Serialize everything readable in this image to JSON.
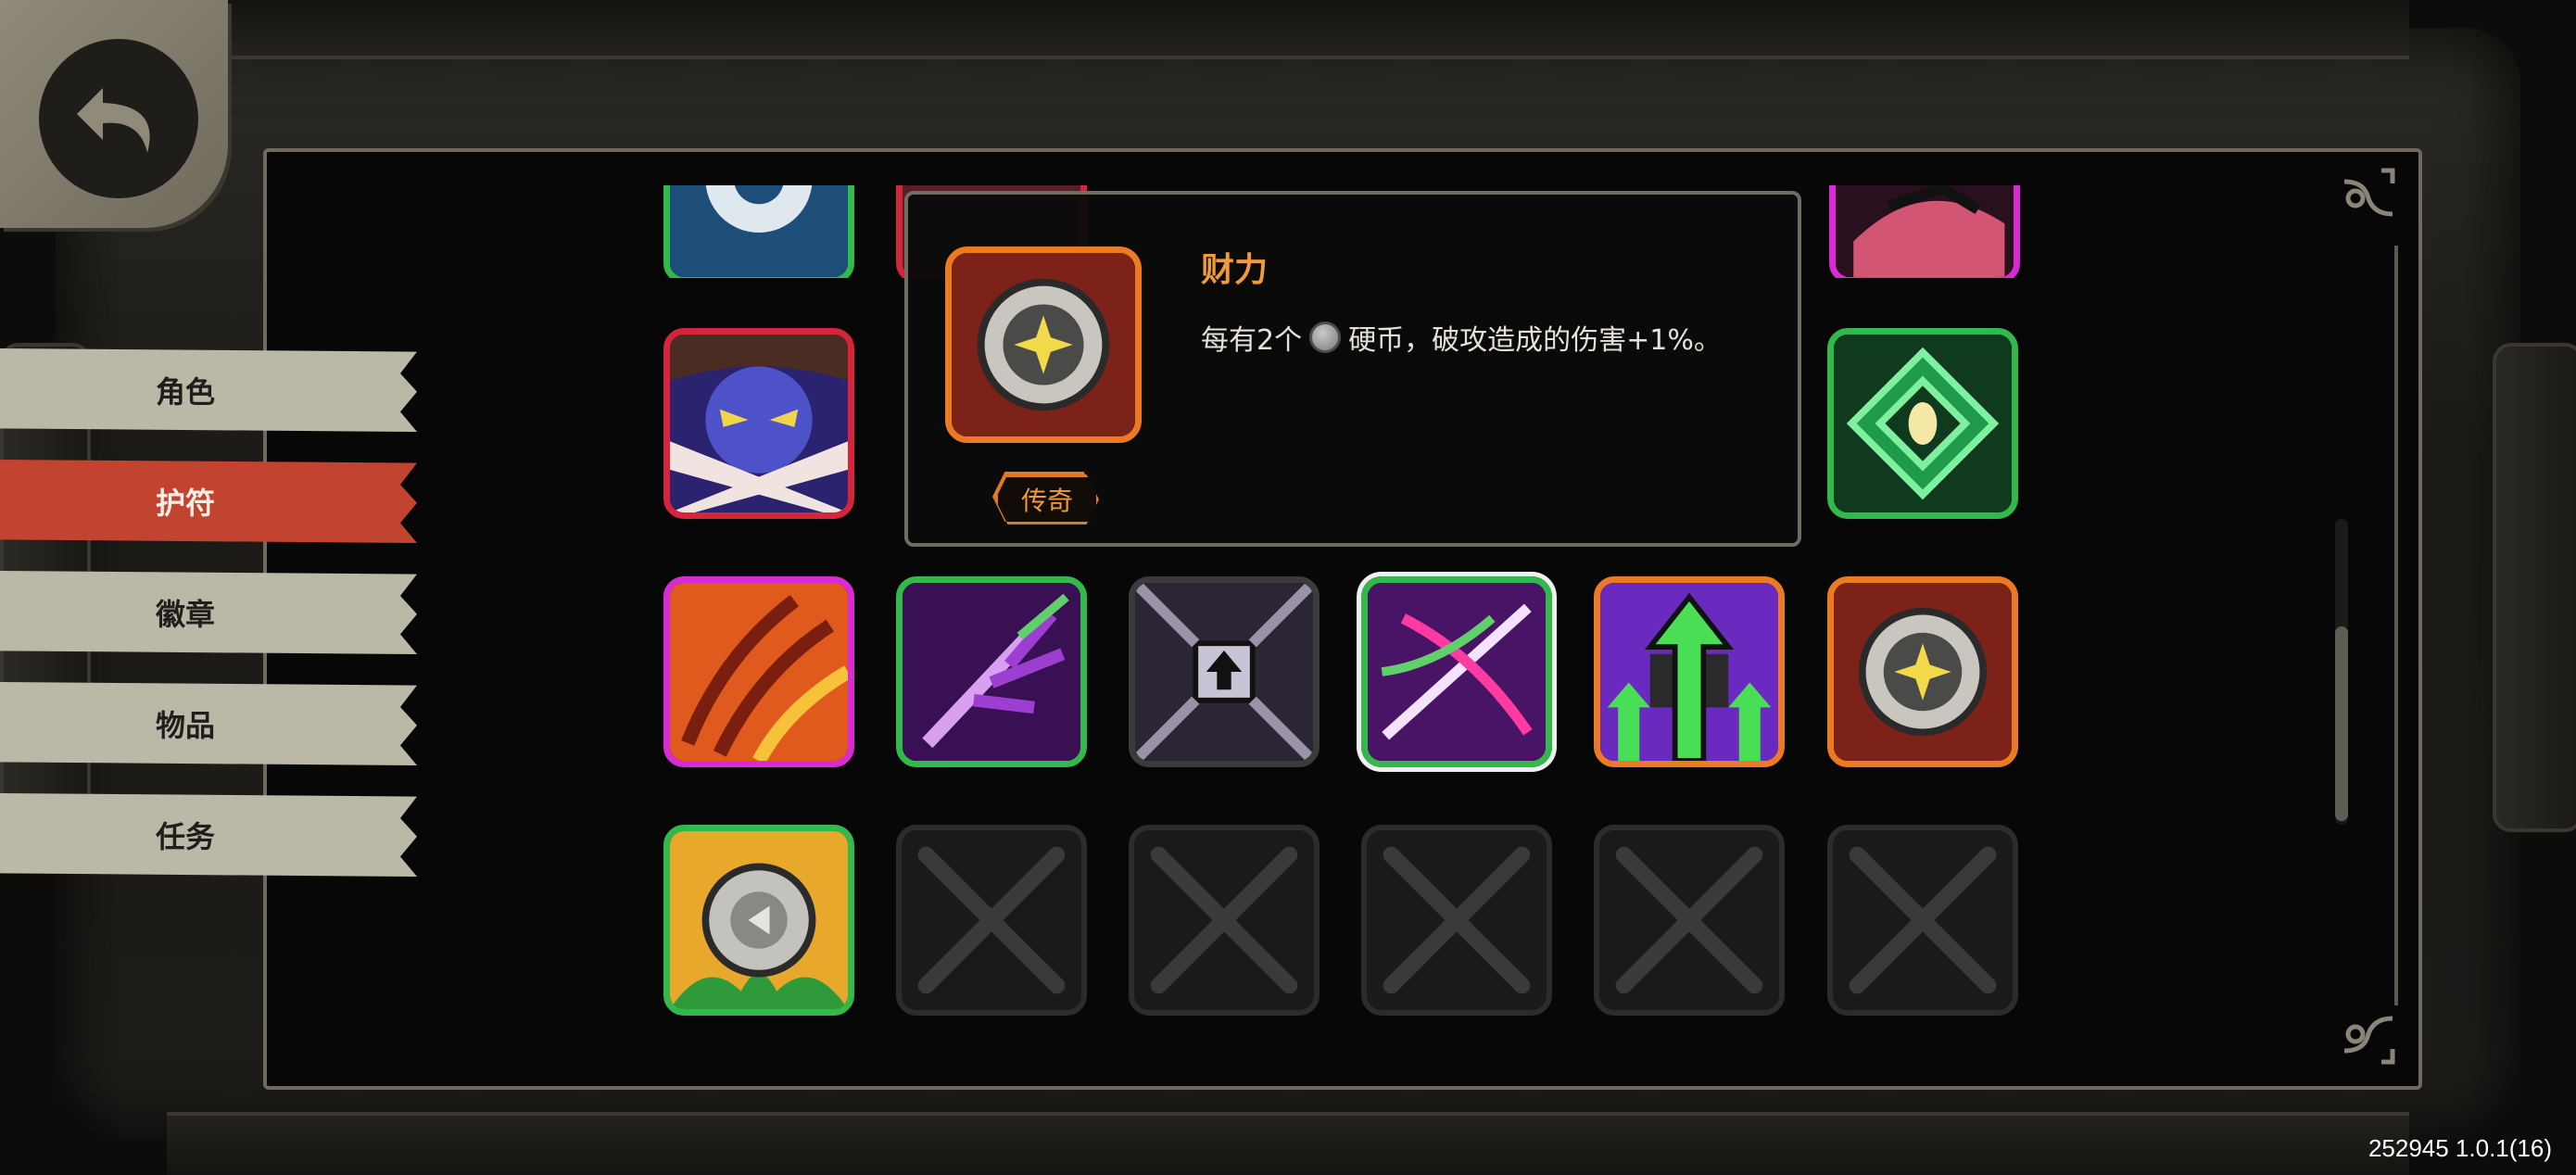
{
  "tabs": [
    {
      "label": "角色",
      "active": false
    },
    {
      "label": "护符",
      "active": true
    },
    {
      "label": "徽章",
      "active": false
    },
    {
      "label": "物品",
      "active": false
    },
    {
      "label": "任务",
      "active": false
    }
  ],
  "tooltip": {
    "title": "财力",
    "desc_before": "每有2个",
    "desc_after": "硬币，破攻造成的伤害+1%。",
    "rarity": "传奇"
  },
  "charms": {
    "row_top": [
      "gear-charm",
      "blade-charm",
      "tooth-charm",
      "horned-charm",
      "rune-charm",
      "claw-charm"
    ],
    "row_2": [
      "masked-warrior-charm",
      "green-charm",
      "spiral-charm",
      "feather-charm",
      "tentacle-charm",
      "green-eye-charm"
    ],
    "row_3": [
      "fire-claw-charm",
      "purple-branch-charm",
      "gate-arrow-charm",
      "slash-charm",
      "green-arrow-charm",
      "coin-charm"
    ],
    "row_4": [
      "leaf-coin-charm",
      "empty",
      "empty",
      "empty",
      "empty",
      "empty"
    ]
  },
  "colors": {
    "legendary": "#ec7a22",
    "active_tab": "#c24330",
    "inactive_tab": "#bcb8a8"
  },
  "icons": [
    "back-arrow-icon",
    "coin-icon",
    "empty-x-icon",
    "corner-ornament-icon"
  ],
  "version": "252945 1.0.1(16)"
}
